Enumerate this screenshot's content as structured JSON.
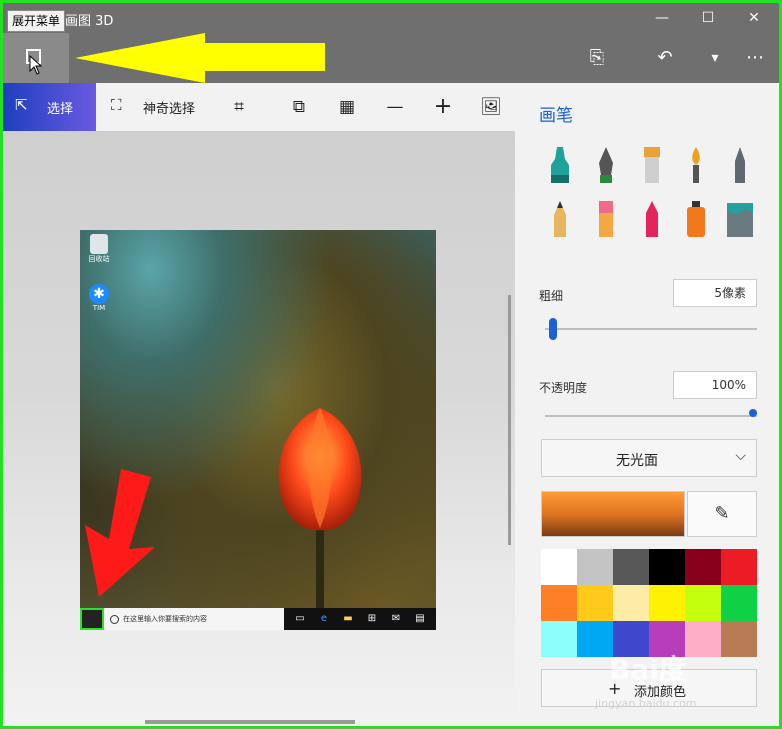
{
  "titlebar": {
    "app_title": "画图 3D",
    "tooltip": "展开菜单",
    "minimize_glyph": "—",
    "maximize_glyph": "☐",
    "close_glyph": "✕"
  },
  "cmdbar": {
    "paste_glyph": "⎘",
    "undo_glyph": "↶",
    "dropdown_glyph": "▾",
    "more_glyph": "⋯"
  },
  "toolbar": {
    "select_label": "选择",
    "magic_select_label": "神奇选择",
    "icons": [
      "crop-icon",
      "3d-view-icon",
      "canvas-grid-icon",
      "minus-icon",
      "plus-icon",
      "image-icon"
    ]
  },
  "canvas": {
    "desktop_icons": [
      "回收站",
      "TIM"
    ],
    "taskbar_search_placeholder": "在这里输入你要搜索的内容"
  },
  "panel": {
    "title": "画笔",
    "thickness_label": "粗细",
    "thickness_value": "5像素",
    "thickness_fraction": 0.05,
    "opacity_label": "不透明度",
    "opacity_value": "100%",
    "opacity_fraction": 1.0,
    "finish_dropdown": "无光面",
    "add_color_label": "添加颜色",
    "palette": [
      "#ffffff",
      "#c3c3c3",
      "#585858",
      "#000000",
      "#88001b",
      "#ec1c24",
      "#ff7f27",
      "#ffca18",
      "#fdeca6",
      "#fff200",
      "#c4ff0e",
      "#0ed145",
      "#8cfffb",
      "#00a8f3",
      "#3f48cc",
      "#b83dba",
      "#ffaec8",
      "#b97a56"
    ]
  },
  "watermark": {
    "text": "Bai度",
    "sub": "jingyan.baidu.com"
  }
}
